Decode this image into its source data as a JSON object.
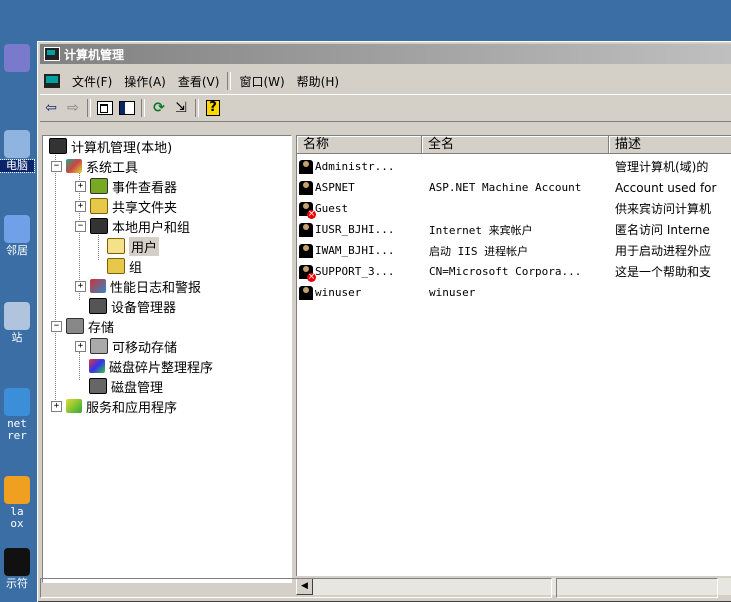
{
  "desktop": {
    "icons": [
      {
        "label": "",
        "icon": "desktop-folder-icon",
        "color": "#7a7acc"
      },
      {
        "label": "电脑",
        "icon": "my-computer-icon",
        "color": "#8fb4e0",
        "selected": true
      },
      {
        "label": "邻居",
        "icon": "network-places-icon",
        "color": "#6fa0e8"
      },
      {
        "label": "站",
        "icon": "recycle-bin-icon",
        "color": "#b0c4de"
      },
      {
        "label": "net\nrer",
        "icon": "internet-explorer-icon",
        "color": "#3b8fd8"
      },
      {
        "label": "la\nox",
        "icon": "firefox-icon",
        "color": "#f0a020"
      },
      {
        "label": "示符",
        "icon": "command-prompt-icon",
        "color": "#111111"
      }
    ]
  },
  "window": {
    "title": "计算机管理",
    "menu": [
      {
        "label": "文件(F)"
      },
      {
        "label": "操作(A)"
      },
      {
        "label": "查看(V)"
      },
      {
        "label": "窗口(W)"
      },
      {
        "label": "帮助(H)"
      }
    ],
    "toolbar": {
      "back": "⇦",
      "forward": "⇨",
      "refresh": "⟳",
      "export": "⇲"
    },
    "tree": [
      {
        "label": "计算机管理(本地)",
        "icon": "computer-management-icon",
        "exp": ""
      },
      {
        "label": "系统工具",
        "icon": "system-tools-icon",
        "exp": "−"
      },
      {
        "label": "事件查看器",
        "icon": "event-viewer-icon",
        "exp": "+"
      },
      {
        "label": "共享文件夹",
        "icon": "shared-folders-icon",
        "exp": "+"
      },
      {
        "label": "本地用户和组",
        "icon": "local-users-groups-icon",
        "exp": "−"
      },
      {
        "label": "用户",
        "icon": "users-folder-icon",
        "exp": ""
      },
      {
        "label": "组",
        "icon": "groups-folder-icon",
        "exp": ""
      },
      {
        "label": "性能日志和警报",
        "icon": "performance-logs-icon",
        "exp": "+"
      },
      {
        "label": "设备管理器",
        "icon": "device-manager-icon",
        "exp": ""
      },
      {
        "label": "存储",
        "icon": "storage-icon",
        "exp": "−"
      },
      {
        "label": "可移动存储",
        "icon": "removable-storage-icon",
        "exp": "+"
      },
      {
        "label": "磁盘碎片整理程序",
        "icon": "disk-defragmenter-icon",
        "exp": ""
      },
      {
        "label": "磁盘管理",
        "icon": "disk-management-icon",
        "exp": ""
      },
      {
        "label": "服务和应用程序",
        "icon": "services-applications-icon",
        "exp": "+"
      }
    ],
    "columns": [
      "名称",
      "全名",
      "描述"
    ],
    "users": [
      {
        "name": "Administr...",
        "full": "",
        "desc": "管理计算机(域)的",
        "disabled": false
      },
      {
        "name": "ASPNET",
        "full": "ASP.NET Machine Account",
        "desc": "Account used for",
        "disabled": false
      },
      {
        "name": "Guest",
        "full": "",
        "desc": "供来宾访问计算机",
        "disabled": true
      },
      {
        "name": "IUSR_BJHI...",
        "full": "Internet 来宾帐户",
        "desc": "匿名访问 Interne",
        "disabled": false
      },
      {
        "name": "IWAM_BJHI...",
        "full": "启动 IIS 进程帐户",
        "desc": "用于启动进程外应",
        "disabled": false
      },
      {
        "name": "SUPPORT_3...",
        "full": "CN=Microsoft Corpora...",
        "desc": "这是一个帮助和支",
        "disabled": true
      },
      {
        "name": "winuser",
        "full": "winuser",
        "desc": "",
        "disabled": false
      }
    ],
    "scroll_left": "◀"
  }
}
